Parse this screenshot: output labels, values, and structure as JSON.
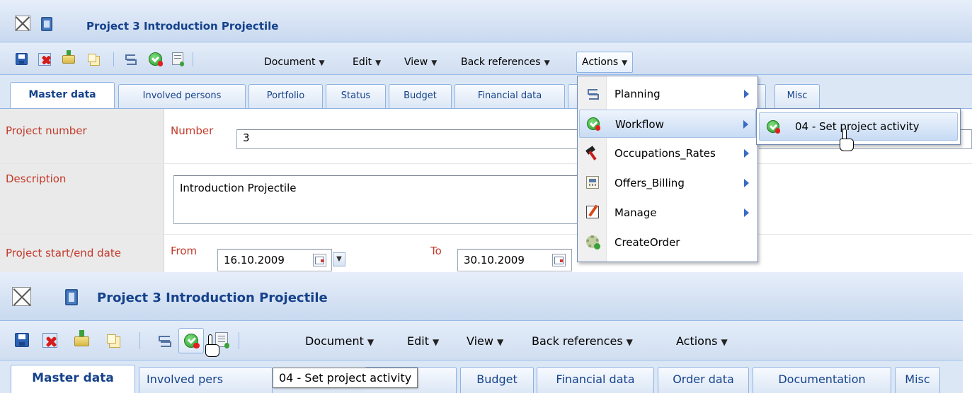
{
  "screen1": {
    "title": "Project 3 Introduction Projectile",
    "toolbar_menus": [
      {
        "label": "Document"
      },
      {
        "label": "Edit"
      },
      {
        "label": "View"
      },
      {
        "label": "Back references"
      },
      {
        "label": "Actions"
      }
    ],
    "tabs": [
      "Master data",
      "Involved persons",
      "Portfolio",
      "Status",
      "Budget",
      "Financial data",
      "",
      "Misc"
    ],
    "form": {
      "project_number_label": "Project number",
      "number_label": "Number",
      "number_value": "3",
      "description_label": "Description",
      "description_value": "Introduction Projectile",
      "dates_label": "Project start/end date",
      "from_label": "From",
      "from_value": "16.10.2009",
      "to_label": "To",
      "to_value": "30.10.2009"
    },
    "actions_menu": {
      "items": [
        {
          "label": "Planning",
          "icon": "planning-icon",
          "submenu": true
        },
        {
          "label": "Workflow",
          "icon": "workflow-icon",
          "submenu": true
        },
        {
          "label": "Occupations_Rates",
          "icon": "hammer-icon",
          "submenu": true
        },
        {
          "label": "Offers_Billing",
          "icon": "calculator-icon",
          "submenu": true
        },
        {
          "label": "Manage",
          "icon": "edit-icon",
          "submenu": true
        },
        {
          "label": "CreateOrder",
          "icon": "gear-icon",
          "submenu": false
        }
      ],
      "highlighted": "Workflow"
    },
    "workflow_submenu": {
      "items": [
        {
          "label": "04 - Set project activity",
          "icon": "workflow-icon"
        }
      ]
    }
  },
  "screen2": {
    "title": "Project 3 Introduction Projectile",
    "toolbar_menus": [
      {
        "label": "Document"
      },
      {
        "label": "Edit"
      },
      {
        "label": "View"
      },
      {
        "label": "Back references"
      },
      {
        "label": "Actions"
      }
    ],
    "tabs": [
      "Master data",
      "Involved persons",
      "",
      "Budget",
      "Financial data",
      "Order data",
      "Documentation",
      "Misc"
    ],
    "tooltip": "04 - Set project activity",
    "tab_fragment": "s",
    "tab_partial": "Involved pers"
  },
  "colors": {
    "accent": "#15428b",
    "label_red": "#c23a2a",
    "menu_border": "#718bb7",
    "header_blue": "#c9d9ef"
  }
}
